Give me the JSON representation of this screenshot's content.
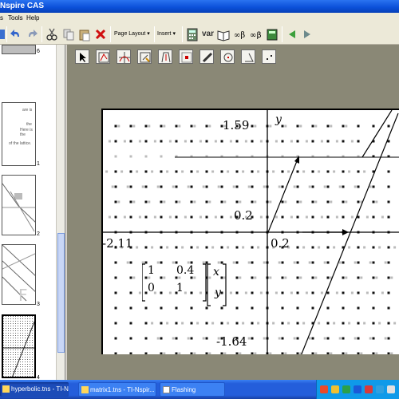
{
  "window": {
    "title": "Nspire CAS"
  },
  "menu": {
    "items": [
      "s",
      "Tools",
      "Help"
    ]
  },
  "toolbar": {
    "page_layout_label": "Page Layout",
    "insert_label": "Insert",
    "var_label": "var",
    "dropdown_glyph": "▾"
  },
  "page_sorter": {
    "pages": [
      {
        "number": "6",
        "text": []
      },
      {
        "number": "1",
        "text": [
          "are is",
          "the",
          "Here is the",
          "of the lattice."
        ]
      },
      {
        "number": "2",
        "text": []
      },
      {
        "number": "3",
        "text": []
      },
      {
        "number": "4",
        "text": []
      }
    ]
  },
  "graph": {
    "y_axis_label": "y",
    "y_max": "1.59",
    "y_min": "-1.64",
    "x_min": "-2.11",
    "x_tick": "0.2",
    "y_tick": "0.2",
    "matrix": {
      "rows": [
        [
          "1",
          "0.4"
        ],
        [
          "0",
          "1"
        ]
      ],
      "vector": [
        "x",
        "y"
      ]
    }
  },
  "taskbar": {
    "tasks": [
      "hyperbolic.tns - TI-Ns...",
      "matrix1.tns - TI-Nspir...",
      "Flashing"
    ]
  },
  "colors": {
    "titlebar": "#0a4fd8",
    "workspace": "#8a8876",
    "taskbar": "#245edb",
    "tray": "#0f9ae9"
  }
}
